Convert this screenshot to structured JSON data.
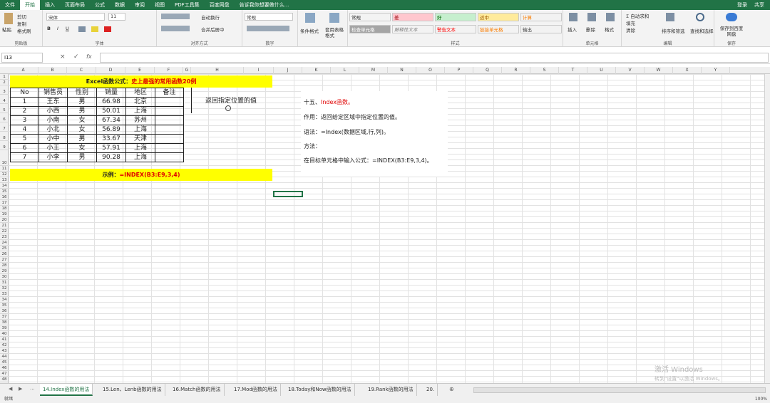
{
  "menu": {
    "items": [
      "文件",
      "开始",
      "插入",
      "页面布局",
      "公式",
      "数据",
      "审阅",
      "视图",
      "PDF工具集",
      "百度网盘",
      "告诉我你想要做什么..."
    ],
    "active_index": 1,
    "login": "登录",
    "share": "共享"
  },
  "ribbon": {
    "clipboard": {
      "paste": "粘贴",
      "cut": "剪切",
      "copy": "复制",
      "format_painter": "格式刷",
      "label": "剪贴板"
    },
    "font": {
      "name": "宋体",
      "size": "11",
      "label": "字体",
      "bold": "B",
      "italic": "I",
      "underline": "U"
    },
    "align": {
      "wrap": "自动换行",
      "merge": "合并后居中",
      "label": "对齐方式"
    },
    "number": {
      "format": "常规",
      "label": "数字"
    },
    "cond": {
      "cond_format": "条件格式",
      "table_format": "套用表格格式"
    },
    "styles": {
      "label": "样式",
      "items": [
        "常规",
        "差",
        "好",
        "适中",
        "计算",
        "检查单元格",
        "解释性文本",
        "警告文本",
        "链接单元格",
        "输出"
      ]
    },
    "cells": {
      "insert": "插入",
      "delete": "删除",
      "format": "格式",
      "label": "单元格"
    },
    "editing": {
      "autosum": "自动求和",
      "fill": "填充",
      "clear": "清除",
      "sort": "排序和筛选",
      "find": "查找和选择",
      "label": "编辑"
    },
    "save": {
      "label": "保存到百度网盘",
      "group": "保存"
    }
  },
  "formula_bar": {
    "name_box": "I13",
    "cancel": "×",
    "confirm": "✓",
    "fx": "fx",
    "value": ""
  },
  "columns": [
    "A",
    "B",
    "C",
    "D",
    "E",
    "F",
    "G",
    "H",
    "I",
    "J",
    "K",
    "L",
    "M",
    "N",
    "O",
    "P",
    "Q",
    "R",
    "S",
    "T",
    "U",
    "V",
    "W",
    "X",
    "Y"
  ],
  "rows": [
    "1",
    "2",
    "3",
    "4",
    "5",
    "6",
    "7",
    "8",
    "9",
    "10",
    "11",
    "12",
    "13",
    "14",
    "15",
    "16",
    "17",
    "18",
    "19",
    "20",
    "21",
    "22",
    "23",
    "24",
    "25",
    "26",
    "27",
    "28",
    "29",
    "30",
    "31",
    "32",
    "33",
    "34",
    "35",
    "36",
    "37",
    "38",
    "39",
    "40",
    "41",
    "42",
    "43",
    "44",
    "45",
    "46",
    "47",
    "48",
    "49",
    "50",
    "51",
    "52",
    "53",
    "54"
  ],
  "sheet": {
    "title_black": "Excel函数公式：",
    "title_red": "史上最强的常用函数20例",
    "headers": [
      "No",
      "销售员",
      "性别",
      "销量",
      "地区",
      "备注"
    ],
    "data": [
      [
        "1",
        "王东",
        "男",
        "66.98",
        "北京",
        ""
      ],
      [
        "2",
        "小西",
        "男",
        "50.01",
        "上海",
        ""
      ],
      [
        "3",
        "小南",
        "女",
        "67.34",
        "苏州",
        ""
      ],
      [
        "4",
        "小北",
        "女",
        "56.89",
        "上海",
        ""
      ],
      [
        "5",
        "小中",
        "男",
        "33.67",
        "天津",
        ""
      ],
      [
        "6",
        "小王",
        "女",
        "57.91",
        "上海",
        ""
      ],
      [
        "7",
        "小李",
        "男",
        "90.28",
        "上海",
        ""
      ]
    ],
    "result_label": "示例：",
    "result_formula": "=INDEX(B3:E9,3,4)",
    "note_h2": "返回指定位置的值",
    "explain_title": "十五、Index函数。",
    "explain_lines": [
      "作用：返回给定区域中指定位置的值。",
      "语法：=Index(数据区域,行,列)。",
      "方法：",
      "在目标单元格中输入公式：=INDEX(B3:E9,3,4)。"
    ]
  },
  "tabs": [
    "14.Index函数的用法",
    "15.Len、Lenb函数的用法",
    "16.Match函数的用法",
    "17.Mod函数的用法",
    "18.Today和Now函数的用法",
    "19.Rank函数的用法",
    "20."
  ],
  "active_tab": 0,
  "status": {
    "mode": "就绪",
    "zoom": "100%"
  },
  "watermark": {
    "line1": "激活 Windows",
    "line2": "转到\"设置\"以激活 Windows。"
  }
}
